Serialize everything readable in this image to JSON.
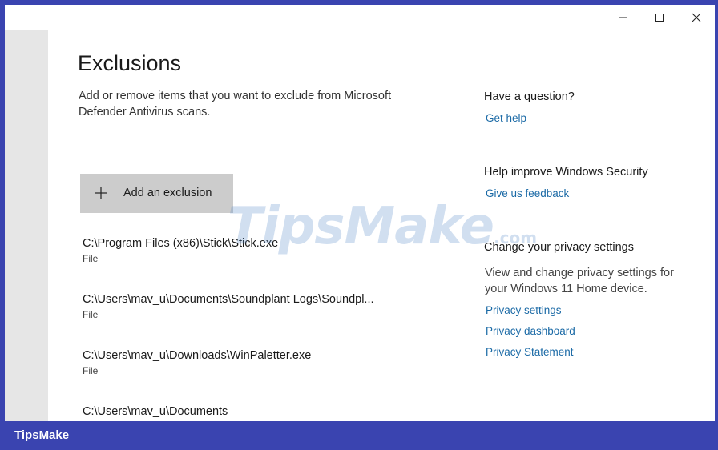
{
  "window": {
    "controls": [
      "minimize",
      "maximize",
      "close"
    ]
  },
  "main": {
    "title": "Exclusions",
    "description": "Add or remove items that you want to exclude from Microsoft Defender Antivirus scans.",
    "add_button_label": "Add an exclusion",
    "exclusions": [
      {
        "path": "C:\\Program Files (x86)\\Stick\\Stick.exe",
        "type": "File"
      },
      {
        "path": "C:\\Users\\mav_u\\Documents\\Soundplant Logs\\Soundpl...",
        "type": "File"
      },
      {
        "path": "C:\\Users\\mav_u\\Downloads\\WinPaletter.exe",
        "type": "File"
      },
      {
        "path": "C:\\Users\\mav_u\\Documents",
        "type": ""
      }
    ]
  },
  "side": {
    "question_heading": "Have a question?",
    "get_help": "Get help",
    "improve_heading": "Help improve Windows Security",
    "feedback": "Give us feedback",
    "privacy_heading": "Change your privacy settings",
    "privacy_text": "View and change privacy settings for your Windows 11 Home device.",
    "privacy_settings": "Privacy settings",
    "privacy_dashboard": "Privacy dashboard",
    "privacy_statement": "Privacy Statement"
  },
  "watermark": {
    "main": "TipsMake",
    "suffix": ".com"
  },
  "footer": {
    "brand": "TipsMake"
  },
  "colors": {
    "frame": "#3a44b0",
    "link": "#1b6aa6",
    "button": "#cccccc",
    "sidebar": "#e6e6e6"
  },
  "icons": [
    "minimize-icon",
    "maximize-icon",
    "close-icon",
    "plus-icon"
  ]
}
